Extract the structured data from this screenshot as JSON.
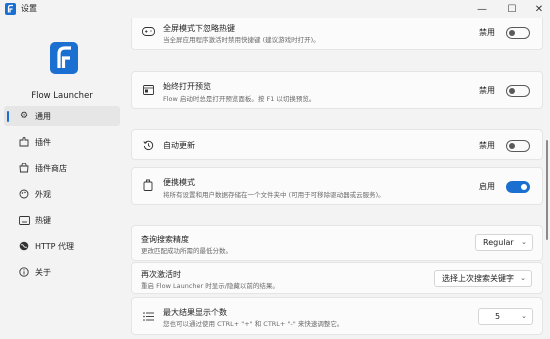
{
  "window": {
    "title": "设置",
    "minimize": "—",
    "maximize": "☐",
    "close": "✕"
  },
  "colors": {
    "accent": "#1a6fd1",
    "background": "#f3f3f3",
    "card": "#fbfbfb"
  },
  "sidebar": {
    "app_name": "Flow Launcher",
    "items": [
      {
        "label": "通用",
        "icon": "gear-icon",
        "active": true
      },
      {
        "label": "插件",
        "icon": "puzzle-icon"
      },
      {
        "label": "插件商店",
        "icon": "store-icon"
      },
      {
        "label": "外观",
        "icon": "palette-icon"
      },
      {
        "label": "热键",
        "icon": "keyboard-icon"
      },
      {
        "label": "HTTP 代理",
        "icon": "globe-icon"
      },
      {
        "label": "关于",
        "icon": "info-icon"
      }
    ]
  },
  "settings": {
    "fullscreen": {
      "title": "全屏模式下忽略热键",
      "desc": "当全屏应用程序激活时禁用快捷键 (建议游戏时打开)。",
      "state": "禁用",
      "icon": "gamepad-icon"
    },
    "preview": {
      "title": "始终打开预览",
      "desc": "Flow 启动时总是打开预览面板。按 F1 以切换预览。",
      "state": "禁用",
      "icon": "preview-icon"
    },
    "autoupdate": {
      "title": "自动更新",
      "state": "禁用",
      "icon": "history-icon"
    },
    "portable": {
      "title": "便携模式",
      "desc": "将所有设置和用户数据存储在一个文件夹中 (可用于可移除驱动器或云服务)。",
      "state": "启用",
      "icon": "portable-icon"
    },
    "search_precision": {
      "title": "查询搜索精度",
      "desc": "更改匹配成功所需的最低分数。",
      "value": "Regular"
    },
    "reactivate": {
      "title": "再次激活时",
      "desc": "重启 Flow Launcher 时显示/隐藏以前的结果。",
      "value": "选择上次搜索关键字"
    },
    "max_results": {
      "title": "最大结果显示个数",
      "desc": "您也可以通过使用 CTRL+ \"+\" 和 CTRL+ \"-\" 来快速调整它。",
      "value": "5",
      "icon": "list-icon"
    }
  }
}
